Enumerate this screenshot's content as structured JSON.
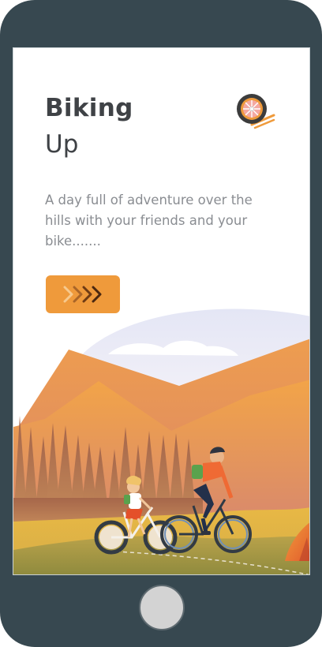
{
  "app": {
    "title": "Biking",
    "subtitle": "Up",
    "description": "A day full of adventure over the hills with your friends and your bike.......",
    "logo_icon": "bike-wheel-logo-icon",
    "go_button_icon": "triple-chevron-right-icon"
  },
  "device": {
    "home_button_icon": "home-button"
  },
  "colors": {
    "accent": "#ef9a3b",
    "frame": "#374850",
    "heading": "#3f4246",
    "body_text": "#8a8d92"
  }
}
